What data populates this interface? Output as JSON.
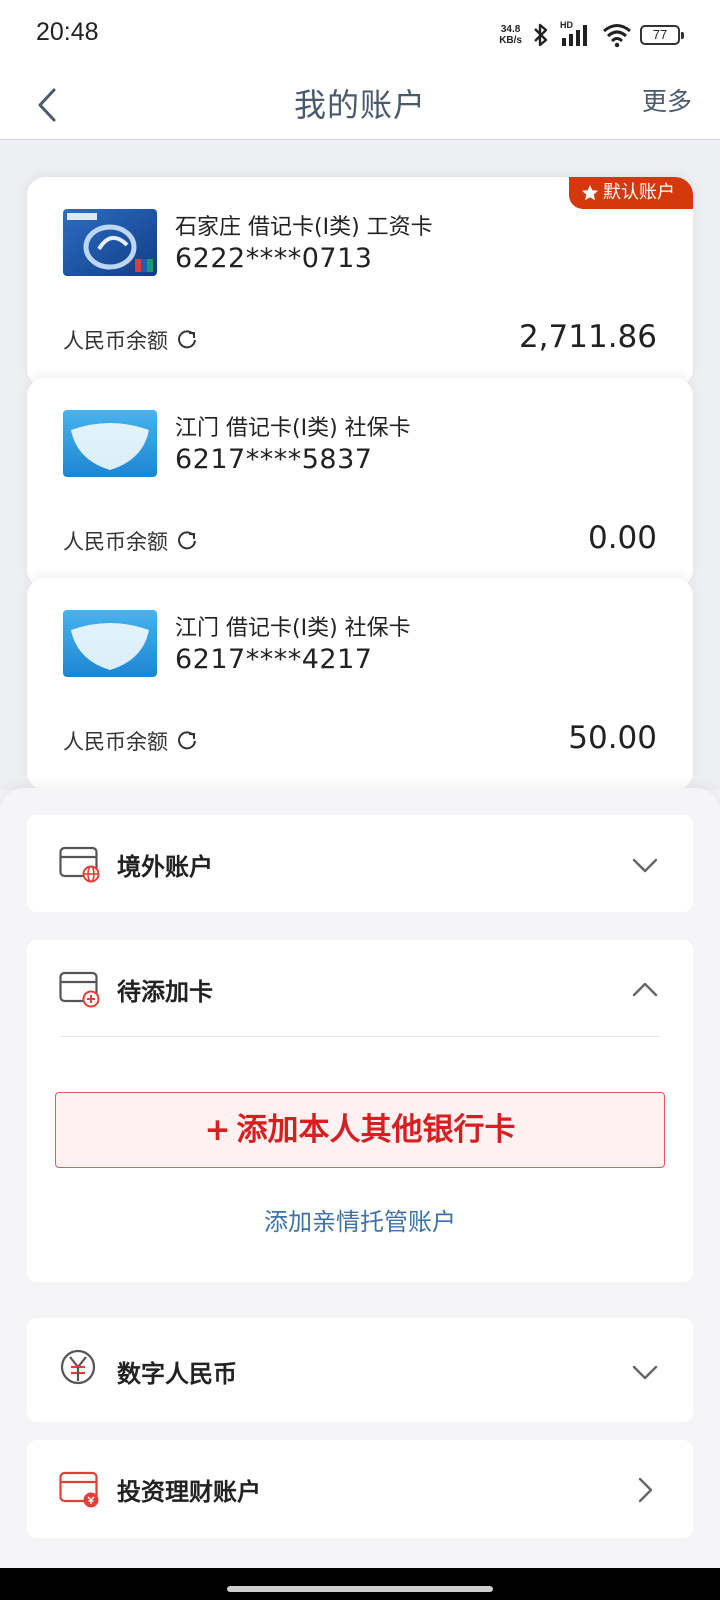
{
  "status_bar": {
    "time": "20:48",
    "speed_value": "34.8",
    "speed_unit": "KB/s",
    "hd_label": "HD",
    "battery": "77"
  },
  "header": {
    "title": "我的账户",
    "more_label": "更多"
  },
  "cards": [
    {
      "name": "石家庄 借记卡(I类) 工资卡",
      "number": "6222****0713",
      "balance_label": "人民币余额",
      "balance": "2,711.86",
      "badge": "默认账户",
      "thumb_text": "ICBC 中国工商银行",
      "thumb_color": "#1d55a6"
    },
    {
      "name": "江门 借记卡(I类)  社保卡",
      "number": "6217****5837",
      "balance_label": "人民币余额",
      "balance": "0.00",
      "thumb_text": "社会保障卡",
      "thumb_color": "#3aa3e0"
    },
    {
      "name": "江门 借记卡(I类)  社保卡",
      "number": "6217****4217",
      "balance_label": "人民币余额",
      "balance": "50.00",
      "thumb_text": "社会保障卡",
      "thumb_color": "#3aa3e0"
    }
  ],
  "sections": {
    "overseas": {
      "label": "境外账户",
      "icon": "card-globe-icon"
    },
    "pending": {
      "label": "待添加卡",
      "icon": "card-plus-icon",
      "add_button": "添加本人其他银行卡",
      "add_family_link": "添加亲情托管账户"
    },
    "digital": {
      "label": "数字人民币",
      "icon": "yuan-icon"
    },
    "invest": {
      "label": "投资理财账户",
      "icon": "card-moneybag-icon"
    }
  },
  "colors": {
    "accent_red": "#d4380d",
    "link_blue": "#3f72a8",
    "title_gray": "#4a5a6e"
  }
}
